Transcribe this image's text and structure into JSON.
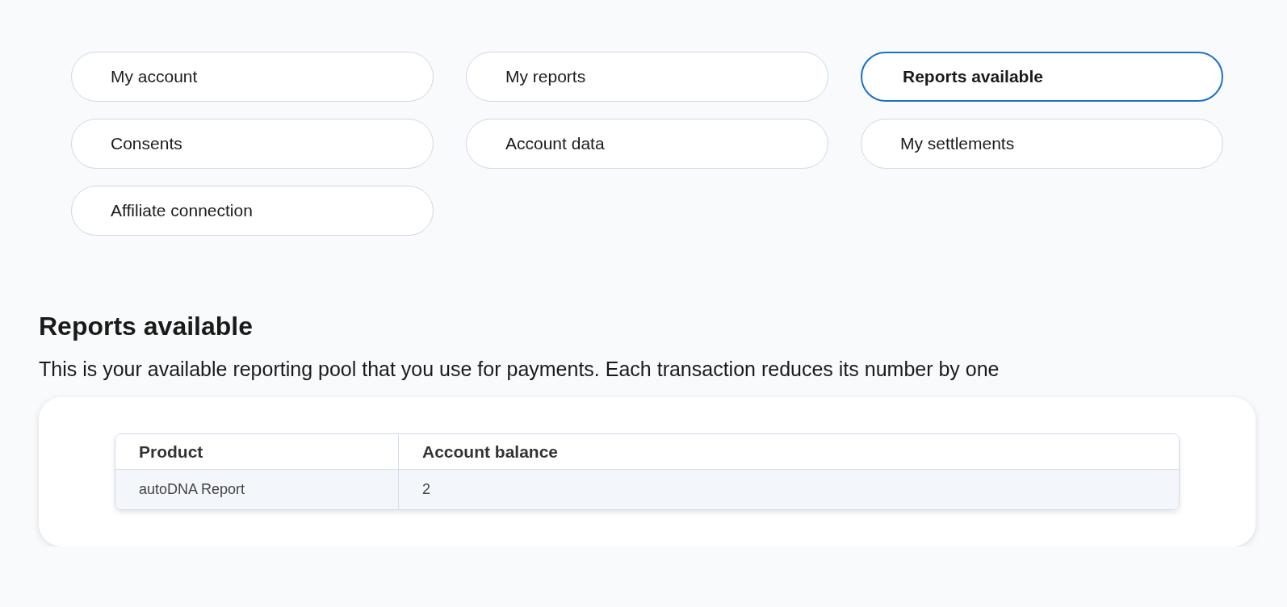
{
  "tabs": [
    {
      "label": "My account",
      "selected": false
    },
    {
      "label": "My reports",
      "selected": false
    },
    {
      "label": "Reports available",
      "selected": true
    },
    {
      "label": "Consents",
      "selected": false
    },
    {
      "label": "Account data",
      "selected": false
    },
    {
      "label": "My settlements",
      "selected": false
    },
    {
      "label": "Affiliate connection",
      "selected": false
    }
  ],
  "section": {
    "title": "Reports available",
    "description": "This is your available reporting pool that you use for payments. Each transaction reduces its number by one"
  },
  "table": {
    "columns": [
      "Product",
      "Account balance"
    ],
    "rows": [
      [
        "autoDNA Report",
        "2"
      ]
    ]
  }
}
